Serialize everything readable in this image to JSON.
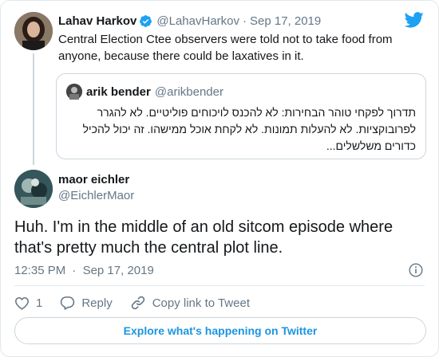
{
  "tweet": {
    "author_name": "Lahav Harkov",
    "author_handle": "@LahavHarkov",
    "separator": "·",
    "date": "Sep 17, 2019",
    "text": "Central Election Ctee observers were told not to take food from anyone, because there could be laxatives in it."
  },
  "quoted": {
    "author_name": "arik bender",
    "author_handle": "@arikbender",
    "text": "תדרוך לפקחי טוהר הבחירות: לא להכנס לויכוחים פוליטיים. לא להגרר לפרובוקציות. לא להעלות תמונות. לא לקחת אוכל ממישהו. זה יכול להכיל כדורים משלשלים..."
  },
  "reply": {
    "author_name": "maor eichler",
    "author_handle": "@EichlerMaor",
    "text": "Huh. I'm in the middle of an old sitcom episode where that's pretty much the central plot line.",
    "time": "12:35 PM",
    "separator": "·",
    "date": "Sep 17, 2019"
  },
  "actions": {
    "like_count": "1",
    "reply_label": "Reply",
    "copy_link_label": "Copy link to Tweet"
  },
  "footer": {
    "explore_label": "Explore what's happening on Twitter"
  },
  "colors": {
    "brand": "#1da1f2",
    "link": "#1b95e0",
    "muted": "#657786",
    "border": "#e1e8ed"
  },
  "icons": [
    "verified-badge-icon",
    "twitter-bird-icon",
    "info-icon",
    "heart-icon",
    "reply-icon",
    "link-icon"
  ]
}
